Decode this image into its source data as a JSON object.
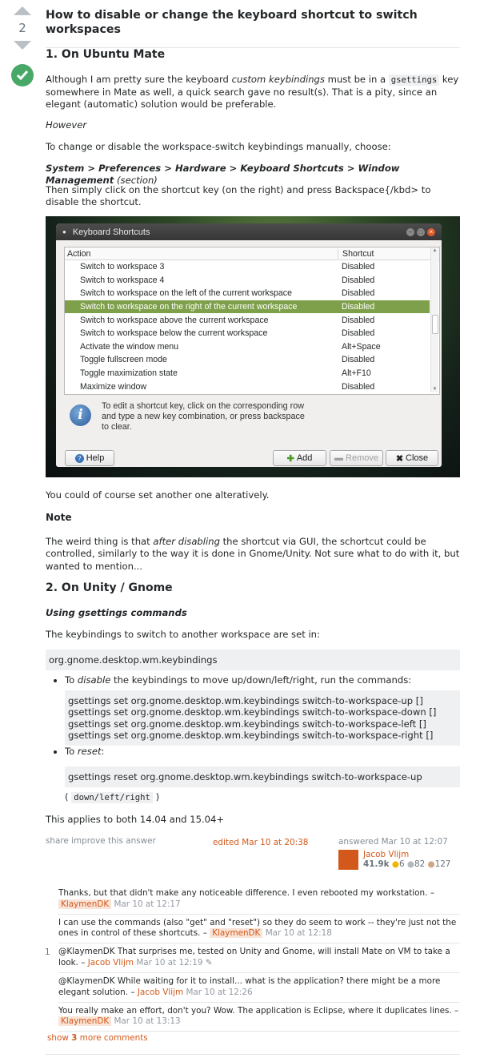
{
  "vote": {
    "count": "2"
  },
  "question_title": "How to disable or change the keyboard shortcut to switch workspaces",
  "section1": {
    "heading": "1. On Ubuntu Mate",
    "p1_a": "Although I am pretty sure the keyboard ",
    "p1_em": "custom keybindings",
    "p1_b": " must be in a ",
    "p1_code": "gsettings",
    "p1_c": " key somewhere in Mate as well, a quick search gave no result(s). That is a pity, since an elegant (automatic) solution would be preferable.",
    "however": "However",
    "p2": "To change or disable the workspace-switch keybindings manually, choose:",
    "path": "System > Preferences > Hardware > Keyboard Shortcuts > Window Management",
    "path_suffix": "(section)",
    "p3": "Then simply click on the shortcut key (on the right) and press Backspace{/kbd> to disable the shortcut."
  },
  "dialog": {
    "title": "Keyboard Shortcuts",
    "col_action": "Action",
    "col_shortcut": "Shortcut",
    "rows": [
      {
        "action": "Switch to workspace 3",
        "shortcut": "Disabled"
      },
      {
        "action": "Switch to workspace 4",
        "shortcut": "Disabled"
      },
      {
        "action": "Switch to workspace on the left of the current workspace",
        "shortcut": "Disabled"
      },
      {
        "action": "Switch to workspace on the right of the current workspace",
        "shortcut": "Disabled"
      },
      {
        "action": "Switch to workspace above the current workspace",
        "shortcut": "Disabled"
      },
      {
        "action": "Switch to workspace below the current workspace",
        "shortcut": "Disabled"
      },
      {
        "action": "Activate the window menu",
        "shortcut": "Alt+Space"
      },
      {
        "action": "Toggle fullscreen mode",
        "shortcut": "Disabled"
      },
      {
        "action": "Toggle maximization state",
        "shortcut": "Alt+F10"
      },
      {
        "action": "Maximize window",
        "shortcut": "Disabled"
      }
    ],
    "info": "To edit a shortcut key, click on the corresponding row and type a new key combination, or press backspace to clear.",
    "help": "Help",
    "add": "Add",
    "remove": "Remove",
    "close": "Close",
    "selected_color": "#7ea04b"
  },
  "after_shot": "You could of course set another one alteratively.",
  "note": {
    "heading": "Note",
    "a": "The weird thing is that ",
    "em": "after disabling",
    "b": " the shortcut via GUI, the schortcut could be controlled, similarly to the way it is done in Gnome/Unity. Not sure what to do with it, but wanted to mention..."
  },
  "section2": {
    "heading": "2. On Unity / Gnome",
    "sub": "Using gsettings commands",
    "p1": "The keybindings to switch to another workspace are set in:",
    "schema": "org.gnome.desktop.wm.keybindings",
    "li1_a": "To ",
    "li1_em": "disable",
    "li1_b": " the keybindings to move up/down/left/right, run the commands:",
    "cmds": "gsettings set org.gnome.desktop.wm.keybindings switch-to-workspace-up []\ngsettings set org.gnome.desktop.wm.keybindings switch-to-workspace-down []\ngsettings set org.gnome.desktop.wm.keybindings switch-to-workspace-left []\ngsettings set org.gnome.desktop.wm.keybindings switch-to-workspace-right []",
    "li2_a": "To ",
    "li2_em": "reset",
    "li2_b": ":",
    "reset_cmd": "gsettings reset org.gnome.desktop.wm.keybindings switch-to-workspace-up",
    "dirs_open": "(",
    "dirs": "down/left/right",
    "dirs_close": ")",
    "applies": "This applies to both 14.04 and 15.04+"
  },
  "post_menu": {
    "share": "share",
    "improve": "improve this answer"
  },
  "edited": "edited Mar 10 at 20:38",
  "answered": {
    "label": "answered Mar 10 at 12:07",
    "user": "Jacob Vlijm",
    "rep": "41.9k",
    "gold": "6",
    "silver": "82",
    "bronze": "127"
  },
  "comments": [
    {
      "score": "",
      "text": "Thanks, but that didn't make any noticeable difference. I even rebooted my workstation. –",
      "user": "KlaymenDK",
      "date": "Mar 10 at 12:17"
    },
    {
      "score": "",
      "text": "I can use the commands (also \"get\" and \"reset\") so they do seem to work -- they're just not the ones in control of these shortcuts. –",
      "user": "KlaymenDK",
      "date": "Mar 10 at 12:18"
    },
    {
      "score": "1",
      "text": "@KlaymenDK That surprises me, tested on Unity and Gnome, will install Mate on VM to take a look. –",
      "user": "Jacob Vlijm",
      "date": "Mar 10 at 12:19"
    },
    {
      "score": "",
      "text": "@KlaymenDK While waiting for it to install... what is the application? there might be a more elegant solution. –",
      "user": "Jacob Vlijm",
      "date": "Mar 10 at 12:26"
    },
    {
      "score": "",
      "text": "You really make an effort, don't you? Wow. The application is Eclipse, where it duplicates lines. –",
      "user": "KlaymenDK",
      "date": "Mar 10 at 13:13"
    }
  ],
  "show_more": {
    "a": "show",
    "n": "3",
    "b": "more comments"
  }
}
